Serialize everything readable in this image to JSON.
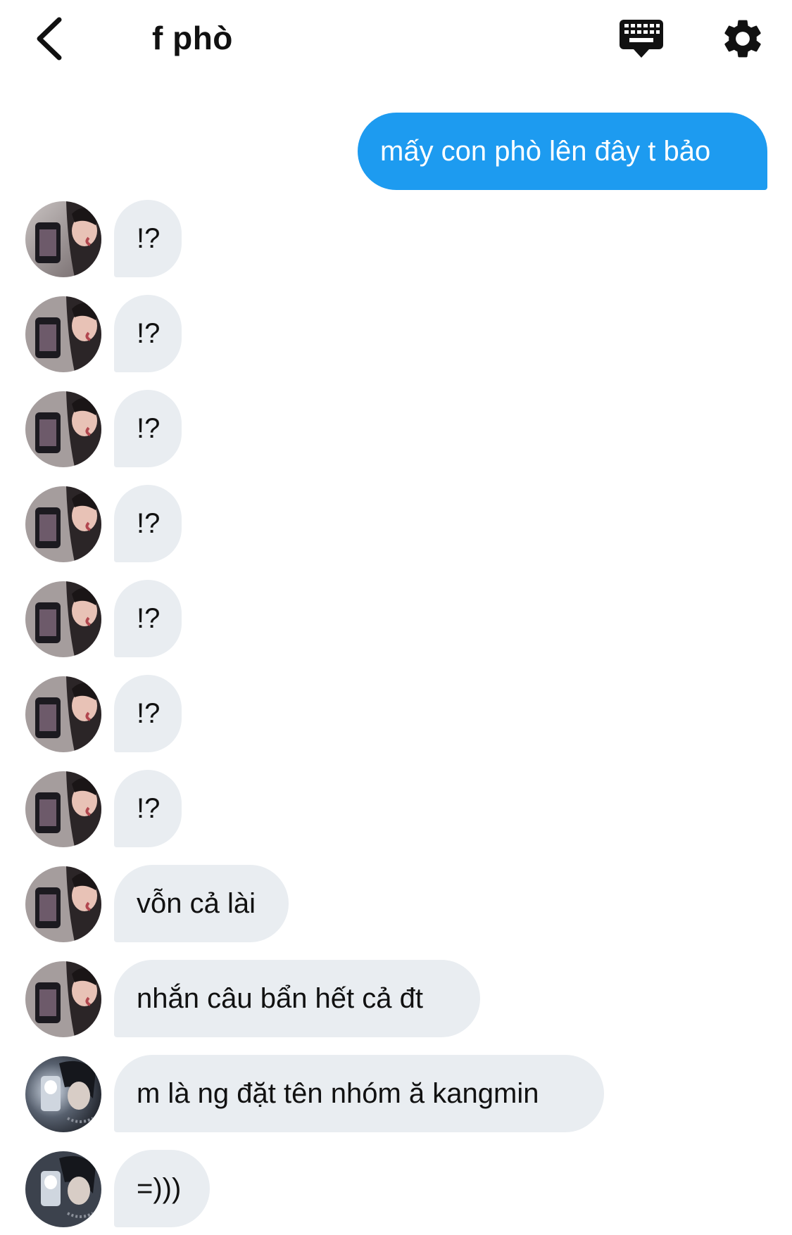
{
  "header": {
    "title": "f phò",
    "back_icon": "chevron-left-icon",
    "keyboard_icon": "keyboard-icon",
    "settings_icon": "gear-icon"
  },
  "colors": {
    "sent_bubble": "#1d9bf0",
    "received_bubble": "#e9edf1"
  },
  "messages": [
    {
      "direction": "sent",
      "text": "mấy con phò lên đây t bảo"
    },
    {
      "direction": "received",
      "sender": "user-1",
      "text": "!?"
    },
    {
      "direction": "received",
      "sender": "user-1",
      "text": "!?"
    },
    {
      "direction": "received",
      "sender": "user-1",
      "text": "!?"
    },
    {
      "direction": "received",
      "sender": "user-1",
      "text": "!?"
    },
    {
      "direction": "received",
      "sender": "user-1",
      "text": "!?"
    },
    {
      "direction": "received",
      "sender": "user-1",
      "text": "!?"
    },
    {
      "direction": "received",
      "sender": "user-1",
      "text": "!?"
    },
    {
      "direction": "received",
      "sender": "user-1",
      "text": "vỗn cả lài"
    },
    {
      "direction": "received",
      "sender": "user-1",
      "text": "nhắn câu bẩn hết cả đt"
    },
    {
      "direction": "received",
      "sender": "user-2",
      "text": "m là ng đặt tên nhóm ă kangmin"
    },
    {
      "direction": "received",
      "sender": "user-2",
      "text": "=)))"
    }
  ]
}
